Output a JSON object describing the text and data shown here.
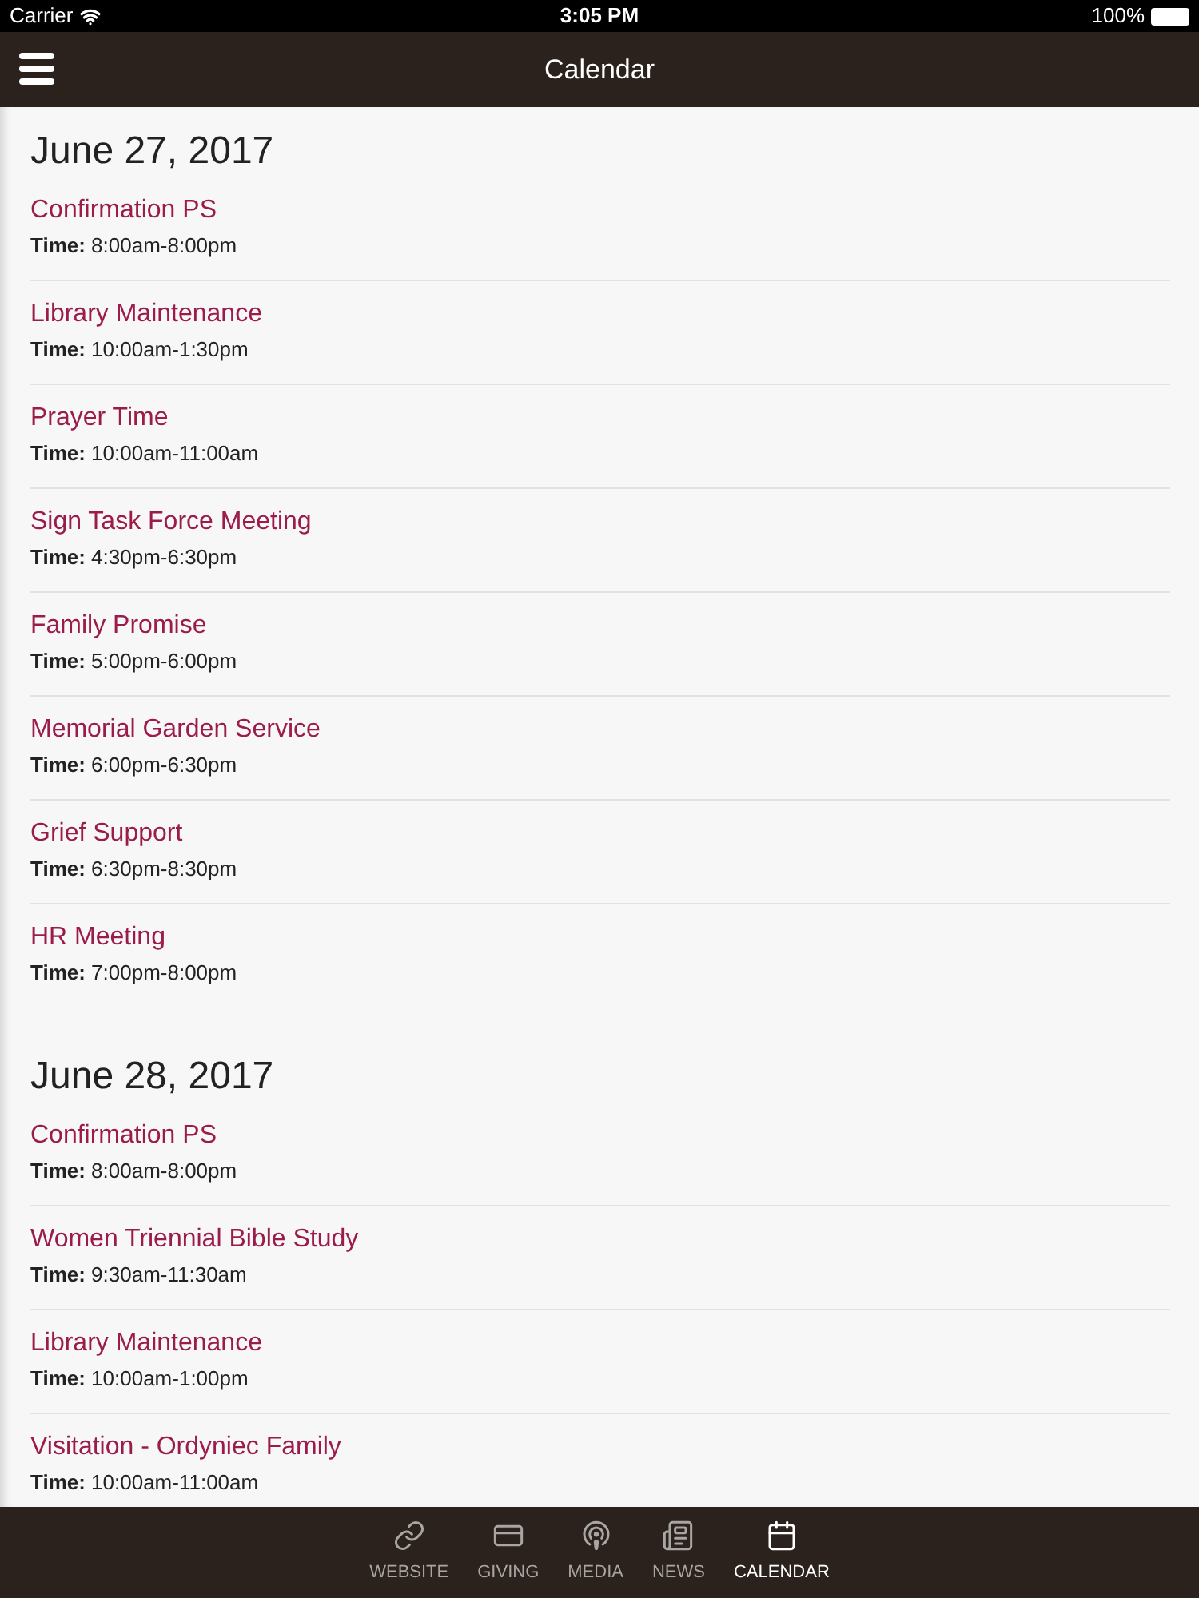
{
  "status_bar": {
    "carrier": "Carrier",
    "time": "3:05 PM",
    "battery": "100%"
  },
  "nav_bar": {
    "title": "Calendar"
  },
  "days": [
    {
      "date": "June 27, 2017",
      "events": [
        {
          "title": "Confirmation PS",
          "time": "**Time:** 8:00am-8:00pm"
        },
        {
          "title": "Library Maintenance",
          "time": "**Time:** 10:00am-1:30pm"
        },
        {
          "title": "Prayer Time",
          "time": "**Time:** 10:00am-11:00am"
        },
        {
          "title": "Sign Task Force Meeting",
          "time": "**Time:** 4:30pm-6:30pm"
        },
        {
          "title": "Family Promise",
          "time": "**Time:** 5:00pm-6:00pm"
        },
        {
          "title": "Memorial Garden Service",
          "time": "**Time:** 6:00pm-6:30pm"
        },
        {
          "title": "Grief Support",
          "time": "**Time:** 6:30pm-8:30pm"
        },
        {
          "title": "HR Meeting",
          "time": "**Time:** 7:00pm-8:00pm"
        }
      ]
    },
    {
      "date": "June 28, 2017",
      "events": [
        {
          "title": "Confirmation PS",
          "time": "**Time:** 8:00am-8:00pm"
        },
        {
          "title": "Women Triennial Bible Study",
          "time": "**Time:** 9:30am-11:30am"
        },
        {
          "title": "Library Maintenance",
          "time": "**Time:** 10:00am-1:00pm"
        },
        {
          "title": "Visitation - Ordyniec Family",
          "time": "**Time:** 10:00am-11:00am"
        }
      ]
    }
  ],
  "tab_bar": [
    {
      "kind": "link",
      "label": "WEBSITE",
      "selected": false
    },
    {
      "kind": "card",
      "label": "GIVING",
      "selected": false
    },
    {
      "kind": "podcast",
      "label": "MEDIA",
      "selected": false
    },
    {
      "kind": "news",
      "label": "NEWS",
      "selected": false
    },
    {
      "kind": "calendar",
      "label": "CALENDAR",
      "selected": true
    }
  ]
}
